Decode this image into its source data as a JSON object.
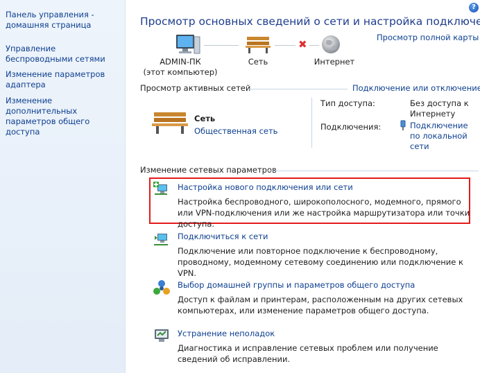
{
  "sidebar": {
    "home": "Панель управления - домашняя страница",
    "items": [
      {
        "label": "Управление беспроводными сетями"
      },
      {
        "label": "Изменение параметров адаптера"
      },
      {
        "label": "Изменение дополнительных параметров общего доступа"
      }
    ]
  },
  "header": {
    "title": "Просмотр основных сведений о сети и настройка подключений",
    "full_map_link": "Просмотр полной карты",
    "help_glyph": "?"
  },
  "network_map": {
    "computer_name": "ADMIN-ПК",
    "computer_sub": "(этот компьютер)",
    "network_label": "Сеть",
    "internet_label": "Интернет",
    "break_glyph": "✖"
  },
  "active_networks": {
    "header": "Просмотр активных сетей",
    "connect_link": "Подключение или отключение",
    "network_name": "Сеть",
    "network_type": "Общественная сеть",
    "access_type_label": "Тип доступа:",
    "access_type_value": "Без доступа к Интернету",
    "connections_label": "Подключения:",
    "connections_value": "Подключение по локальной сети"
  },
  "change_settings": {
    "header": "Изменение сетевых параметров",
    "tasks": [
      {
        "title": "Настройка нового подключения или сети",
        "desc": "Настройка беспроводного, широкополосного, модемного, прямого или VPN-подключения или же настройка маршрутизатора или точки доступа."
      },
      {
        "title": "Подключиться к сети",
        "desc": "Подключение или повторное подключение к беспроводному, проводному, модемному сетевому соединению или подключение к VPN."
      },
      {
        "title": "Выбор домашней группы и параметров общего доступа",
        "desc": "Доступ к файлам и принтерам, расположенным на других сетевых компьютерах, или изменение параметров общего доступа."
      },
      {
        "title": "Устранение неполадок",
        "desc": "Диагностика и исправление сетевых проблем или получение сведений об исправлении."
      }
    ]
  },
  "colors": {
    "link": "#0d3f8f",
    "title": "#1e3d8f",
    "highlight": "#e41a1a",
    "sidebar_bg": "#e9f0fa"
  }
}
